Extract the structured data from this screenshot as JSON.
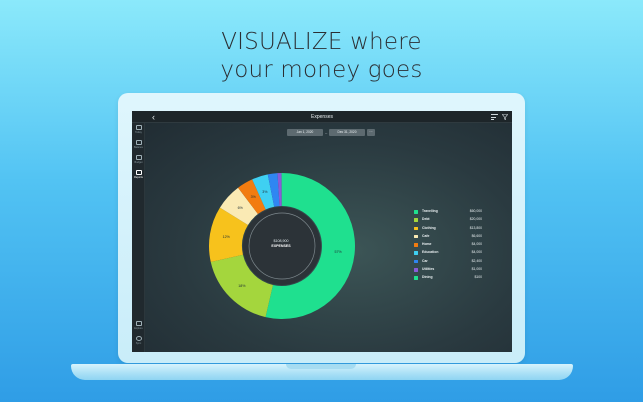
{
  "headline": {
    "line1": "VISUALIZE where",
    "line2": "your money goes"
  },
  "app": {
    "title": "Expenses",
    "back_icon": "chevron-left-icon",
    "menu_icon": "sort-lines-icon",
    "filter_icon": "filter-icon"
  },
  "sidebar": {
    "items": [
      {
        "label": "Today",
        "icon": "calendar-icon",
        "active": false
      },
      {
        "label": "Balance",
        "icon": "balance-icon",
        "active": false
      },
      {
        "label": "Budget",
        "icon": "budget-icon",
        "active": false
      },
      {
        "label": "Reports",
        "icon": "bar-chart-icon",
        "active": true
      }
    ],
    "bottom_items": [
      {
        "label": "Explore",
        "icon": "explore-icon"
      },
      {
        "label": "Sync",
        "icon": "sync-icon"
      }
    ]
  },
  "date_range": {
    "start": "Jan 1, 2020",
    "end": "Dec 31, 2020",
    "separator": "–",
    "more": "···"
  },
  "center": {
    "total": "$108,900",
    "label": "EXPENSES"
  },
  "colors": {
    "Travelling": "#1fe08f",
    "Debt": "#a4d63d",
    "Clothing": "#f7c21c",
    "Cafe": "#faeab4",
    "Home": "#f27c10",
    "Education": "#3fd0f2",
    "Car": "#2f86f2",
    "Utilities": "#8a5bd9",
    "Dining": "#1fe08f"
  },
  "chart_data": {
    "type": "pie",
    "title": "",
    "center_text": [
      "$108,900",
      "EXPENSES"
    ],
    "slices": [
      {
        "label": "Travelling",
        "amount": "$60,000",
        "value": 60000,
        "percent_label": "57%"
      },
      {
        "label": "Debt",
        "amount": "$20,000",
        "value": 20000,
        "percent_label": "18%"
      },
      {
        "label": "Clothing",
        "amount": "$13,800",
        "value": 13800,
        "percent_label": "12%"
      },
      {
        "label": "Cafe",
        "amount": "$6,600",
        "value": 6600,
        "percent_label": "6%"
      },
      {
        "label": "Home",
        "amount": "$4,000",
        "value": 4000,
        "percent_label": "3%"
      },
      {
        "label": "Education",
        "amount": "$4,000",
        "value": 4000,
        "percent_label": "3%"
      },
      {
        "label": "Car",
        "amount": "$2,400",
        "value": 2400,
        "percent_label": ""
      },
      {
        "label": "Utilities",
        "amount": "$1,000",
        "value": 1000,
        "percent_label": ""
      },
      {
        "label": "Dining",
        "amount": "$100",
        "value": 100,
        "percent_label": ""
      }
    ],
    "legend_position": "right"
  }
}
